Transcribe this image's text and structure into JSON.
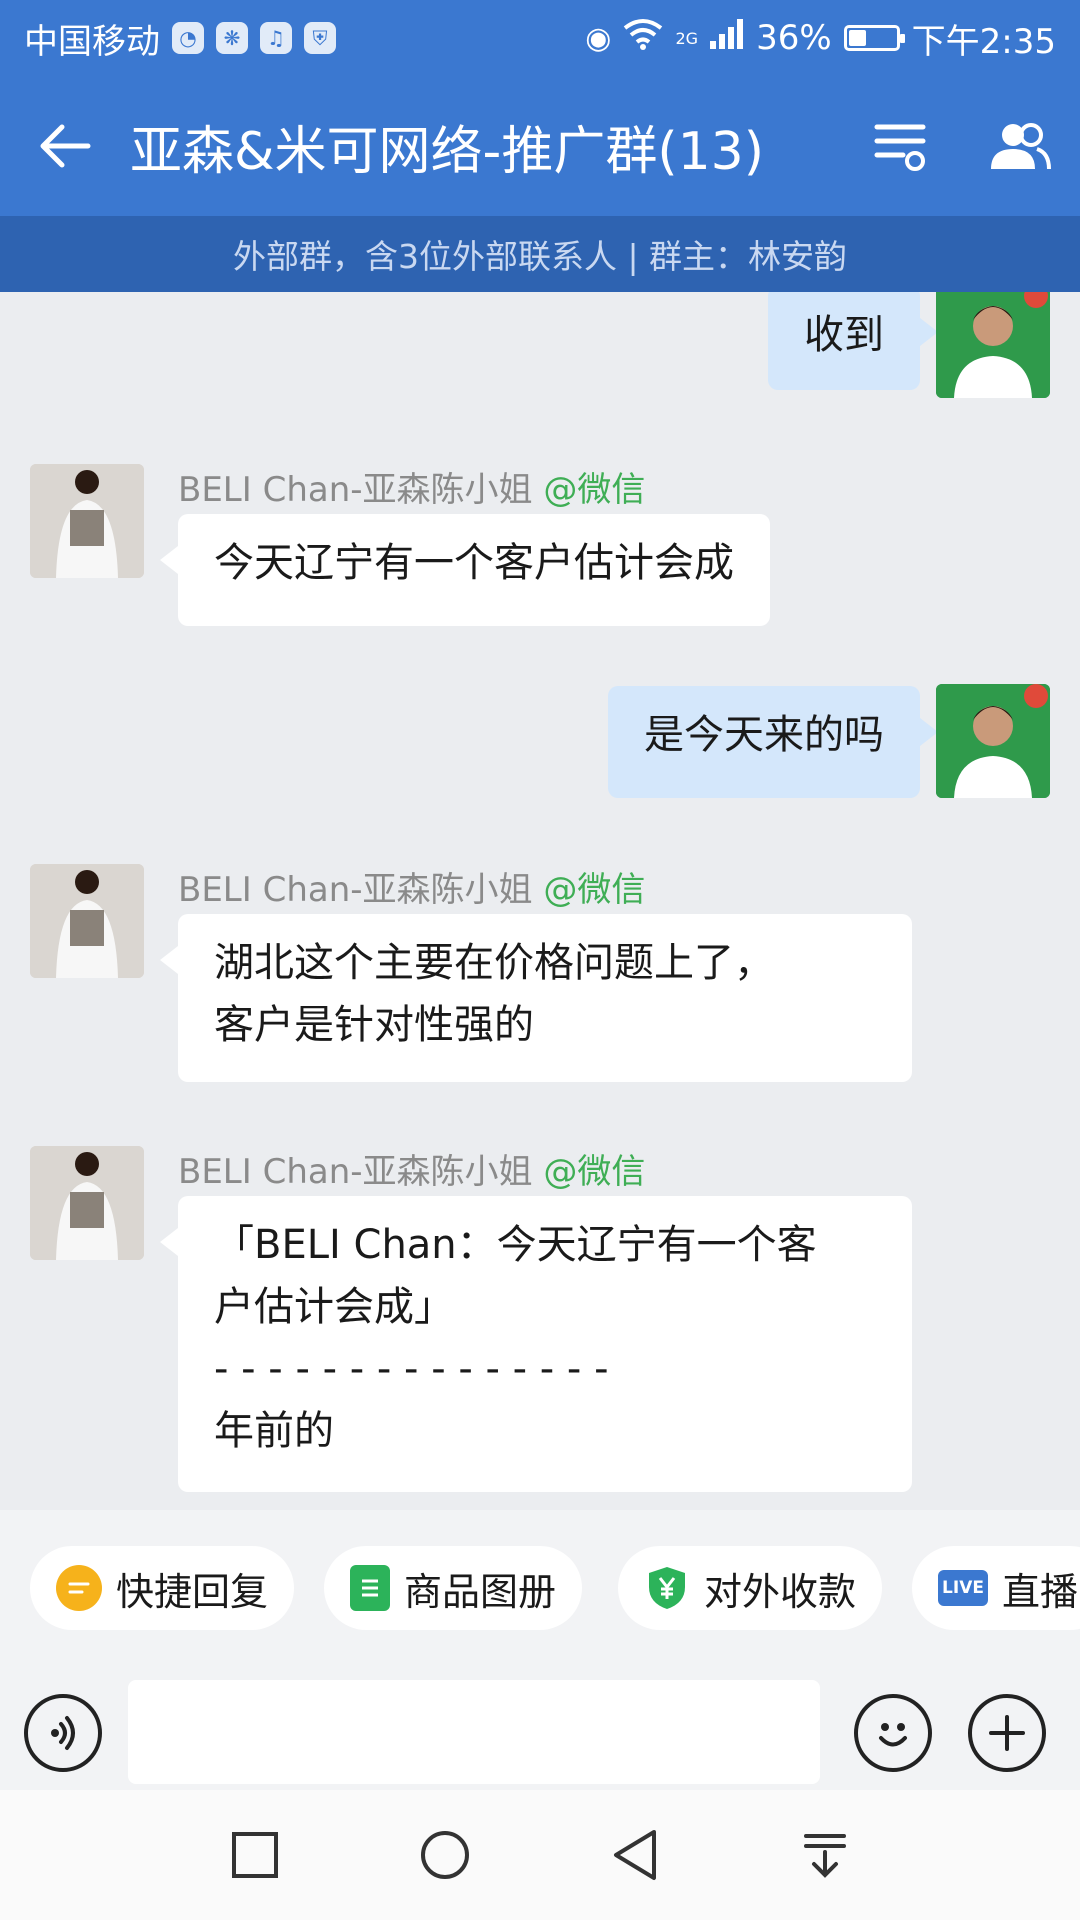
{
  "status_bar": {
    "carrier": "中国移动",
    "network": "2G",
    "battery": "36%",
    "battery_level": 0.36,
    "time": "下午2:35"
  },
  "header": {
    "title": "亚森&米可网络-推广群(13)",
    "subtitle": "外部群，含3位外部联系人 | 群主：林安韵"
  },
  "messages": [
    {
      "direction": "out",
      "lines": [
        "收到"
      ]
    },
    {
      "direction": "in",
      "sender": "BELI Chan-亚森陈小姐",
      "tag": "@微信",
      "lines": [
        "今天辽宁有一个客户估计会成"
      ]
    },
    {
      "direction": "out",
      "lines": [
        "是今天来的吗"
      ]
    },
    {
      "direction": "in",
      "sender": "BELI Chan-亚森陈小姐",
      "tag": "@微信",
      "lines": [
        "湖北这个主要在价格问题上了，",
        "客户是针对性强的"
      ]
    },
    {
      "direction": "in",
      "sender": "BELI Chan-亚森陈小姐",
      "tag": "@微信",
      "lines": [
        "「BELI Chan：今天辽宁有一个客",
        "户估计会成」",
        "- - - - - - - - - - - - - - -",
        "年前的"
      ]
    }
  ],
  "quick_actions": [
    {
      "label": "快捷回复",
      "icon": "quick-reply-icon",
      "color": "#f6b21b"
    },
    {
      "label": "商品图册",
      "icon": "product-album-icon",
      "color": "#2cb35a"
    },
    {
      "label": "对外收款",
      "icon": "payment-icon",
      "color": "#2cb35a"
    },
    {
      "label": "直播",
      "icon": "live-icon",
      "color": "#3b78d0",
      "badge": "LIVE"
    }
  ],
  "colors": {
    "header": "#3b78d0",
    "subheader": "#2e63b1",
    "outgoing_bubble": "#d4e7fb",
    "incoming_bubble": "#ffffff",
    "wechat_tag": "#3fae55"
  }
}
